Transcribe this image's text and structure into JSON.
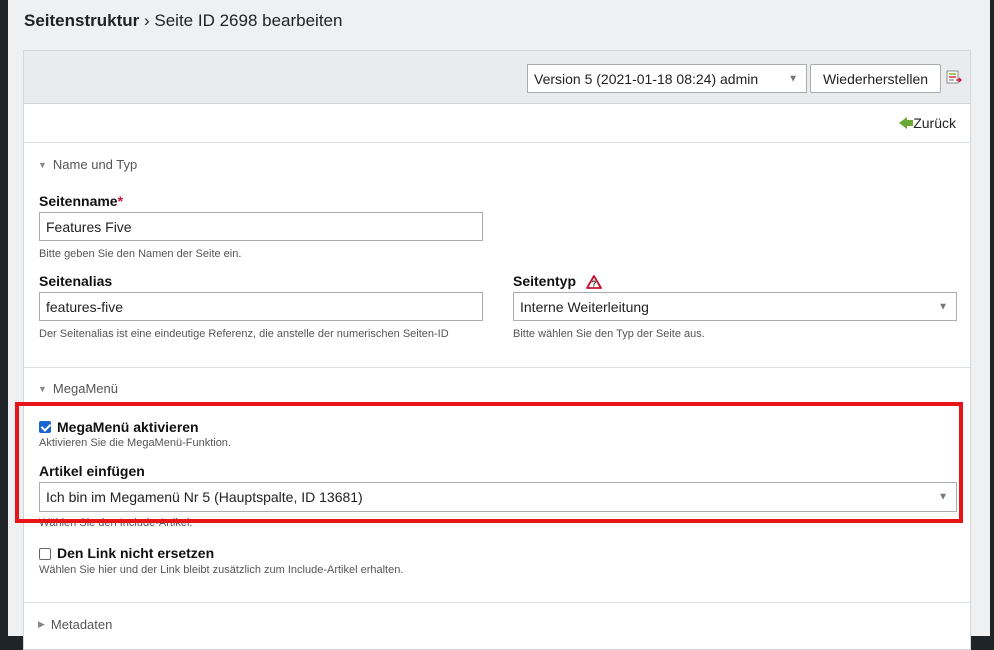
{
  "header": {
    "crumb": "Seitenstruktur",
    "separator": "›",
    "title": "Seite ID 2698 bearbeiten"
  },
  "version_bar": {
    "version_select": "Version 5 (2021-01-18 08:24) admin",
    "restore_button": "Wiederherstellen",
    "diff_icon": "document-compare-icon"
  },
  "back_label": "Zurück",
  "sections": {
    "name_type": {
      "legend": "Name und Typ",
      "seitenname_label": "Seitenname",
      "seitenname_required": "*",
      "seitenname_value": "Features Five",
      "seitenname_hint": "Bitte geben Sie den Namen der Seite ein.",
      "alias_label": "Seitenalias",
      "alias_value": "features-five",
      "alias_hint": "Der Seitenalias ist eine eindeutige Referenz, die anstelle der numerischen Seiten-ID",
      "type_label": "Seitentyp",
      "type_value": "Interne Weiterleitung",
      "type_hint": "Bitte wählen Sie den Typ der Seite aus."
    },
    "megamenu": {
      "legend": "MegaMenü",
      "activate_label": "MegaMenü aktivieren",
      "activate_checked": true,
      "activate_hint": "Aktivieren Sie die MegaMenü-Funktion.",
      "article_label": "Artikel einfügen",
      "article_value": "Ich bin im Megamenü Nr 5 (Hauptspalte, ID 13681)",
      "article_hint": "Wählen Sie den Include-Artikel.",
      "nolink_label": "Den Link nicht ersetzen",
      "nolink_checked": false,
      "nolink_hint": "Wählen Sie hier und der Link bleibt zusätzlich zum Include-Artikel erhalten."
    },
    "metadata": {
      "legend": "Metadaten"
    }
  },
  "colors": {
    "highlight": "#e8141a",
    "checkbox": "#1a64d0",
    "back_arrow": "#6aa936"
  }
}
